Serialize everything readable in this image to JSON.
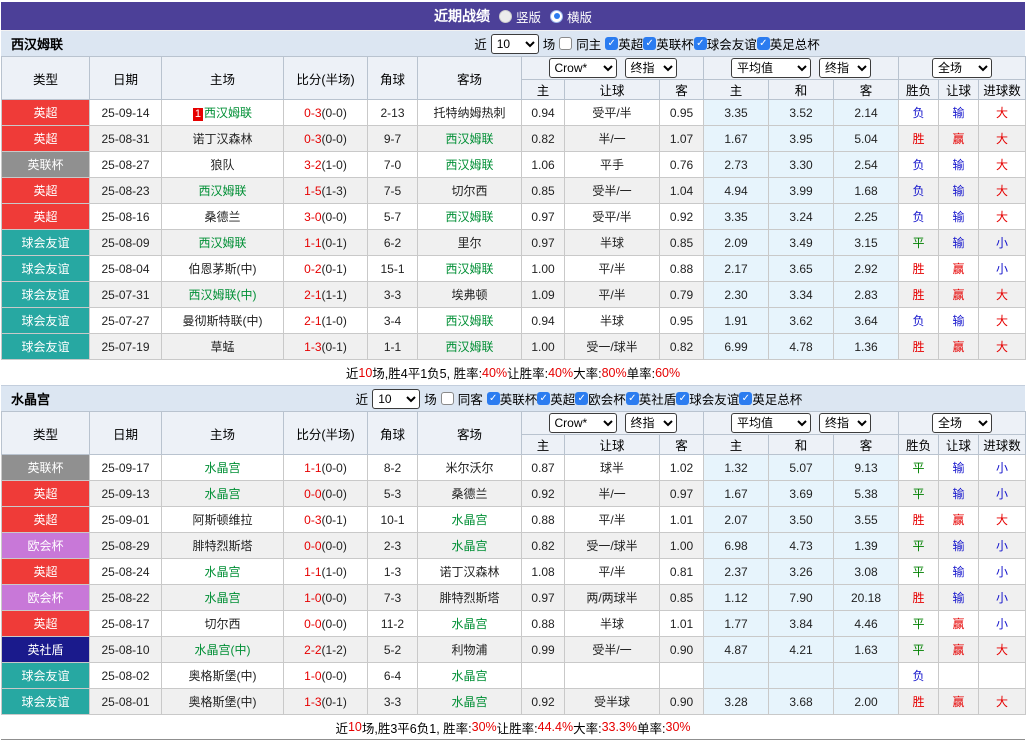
{
  "title_bar": {
    "title": "近期战绩",
    "options": [
      {
        "label": "竖版",
        "selected": false
      },
      {
        "label": "横版",
        "selected": true
      }
    ]
  },
  "table_headers": {
    "main": [
      "类型",
      "日期",
      "主场",
      "比分(半场)",
      "角球",
      "客场"
    ],
    "crow_sub": [
      "主",
      "让球",
      "客"
    ],
    "avg_sub": [
      "主",
      "和",
      "客"
    ],
    "full_sub": [
      "胜负",
      "让球",
      "进球数"
    ]
  },
  "colors": {
    "header_purple": "#4C4098",
    "filter_bar": "#DCE6F2",
    "focus_team_green": "#008F35",
    "score_red": "#E60000",
    "win_red": "#E60000",
    "draw_green": "#008000",
    "lose_blue": "#1414CC"
  },
  "badge_colors": {
    "英超": "#EF3B38",
    "英联杯": "#909090",
    "球会友谊": "#27A8A2",
    "欧会杯": "#C878D8",
    "英社盾": "#1A1A8C"
  },
  "sections": [
    {
      "team": "西汉姆联",
      "filter": {
        "prefix": "近",
        "count": "10",
        "suffix": "场",
        "same_checkbox": {
          "label": "同主",
          "checked": false
        },
        "leagues": [
          "英超",
          "英联杯",
          "球会友谊",
          "英足总杯"
        ]
      },
      "selects": {
        "crow": "Crow*",
        "crow_period": "终指",
        "avg": "平均值",
        "avg_period": "终指",
        "full": "全场"
      },
      "rows": [
        {
          "league": "英超",
          "date": "25-09-14",
          "home": "西汉姆联",
          "home_focus": true,
          "home_rank": "1",
          "score": "0-3",
          "half": "(0-0)",
          "corner": "2-13",
          "away": "托特纳姆热刺",
          "away_focus": false,
          "odds": [
            "0.94",
            "受平/半",
            "0.95"
          ],
          "avg": [
            "3.35",
            "3.52",
            "2.14"
          ],
          "result": "负",
          "handicap": "输",
          "goals": "大"
        },
        {
          "league": "英超",
          "date": "25-08-31",
          "home": "诺丁汉森林",
          "home_focus": false,
          "home_rank": "",
          "score": "0-3",
          "half": "(0-0)",
          "corner": "9-7",
          "away": "西汉姆联",
          "away_focus": true,
          "odds": [
            "0.82",
            "半/一",
            "1.07"
          ],
          "avg": [
            "1.67",
            "3.95",
            "5.04"
          ],
          "result": "胜",
          "handicap": "赢",
          "goals": "大"
        },
        {
          "league": "英联杯",
          "date": "25-08-27",
          "home": "狼队",
          "home_focus": false,
          "home_rank": "",
          "score": "3-2",
          "half": "(1-0)",
          "corner": "7-0",
          "away": "西汉姆联",
          "away_focus": true,
          "odds": [
            "1.06",
            "平手",
            "0.76"
          ],
          "avg": [
            "2.73",
            "3.30",
            "2.54"
          ],
          "result": "负",
          "handicap": "输",
          "goals": "大"
        },
        {
          "league": "英超",
          "date": "25-08-23",
          "home": "西汉姆联",
          "home_focus": true,
          "home_rank": "",
          "score": "1-5",
          "half": "(1-3)",
          "corner": "7-5",
          "away": "切尔西",
          "away_focus": false,
          "odds": [
            "0.85",
            "受半/一",
            "1.04"
          ],
          "avg": [
            "4.94",
            "3.99",
            "1.68"
          ],
          "result": "负",
          "handicap": "输",
          "goals": "大"
        },
        {
          "league": "英超",
          "date": "25-08-16",
          "home": "桑德兰",
          "home_focus": false,
          "home_rank": "",
          "score": "3-0",
          "half": "(0-0)",
          "corner": "5-7",
          "away": "西汉姆联",
          "away_focus": true,
          "odds": [
            "0.97",
            "受平/半",
            "0.92"
          ],
          "avg": [
            "3.35",
            "3.24",
            "2.25"
          ],
          "result": "负",
          "handicap": "输",
          "goals": "大"
        },
        {
          "league": "球会友谊",
          "date": "25-08-09",
          "home": "西汉姆联",
          "home_focus": true,
          "home_rank": "",
          "score": "1-1",
          "half": "(0-1)",
          "corner": "6-2",
          "away": "里尔",
          "away_focus": false,
          "odds": [
            "0.97",
            "半球",
            "0.85"
          ],
          "avg": [
            "2.09",
            "3.49",
            "3.15"
          ],
          "result": "平",
          "handicap": "输",
          "goals": "小"
        },
        {
          "league": "球会友谊",
          "date": "25-08-04",
          "home": "伯恩茅斯(中)",
          "home_focus": false,
          "home_rank": "",
          "score": "0-2",
          "half": "(0-1)",
          "corner": "15-1",
          "away": "西汉姆联",
          "away_focus": true,
          "odds": [
            "1.00",
            "平/半",
            "0.88"
          ],
          "avg": [
            "2.17",
            "3.65",
            "2.92"
          ],
          "result": "胜",
          "handicap": "赢",
          "goals": "小"
        },
        {
          "league": "球会友谊",
          "date": "25-07-31",
          "home": "西汉姆联(中)",
          "home_focus": true,
          "home_rank": "",
          "score": "2-1",
          "half": "(1-1)",
          "corner": "3-3",
          "away": "埃弗顿",
          "away_focus": false,
          "odds": [
            "1.09",
            "平/半",
            "0.79"
          ],
          "avg": [
            "2.30",
            "3.34",
            "2.83"
          ],
          "result": "胜",
          "handicap": "赢",
          "goals": "大"
        },
        {
          "league": "球会友谊",
          "date": "25-07-27",
          "home": "曼彻斯特联(中)",
          "home_focus": false,
          "home_rank": "",
          "score": "2-1",
          "half": "(1-0)",
          "corner": "3-4",
          "away": "西汉姆联",
          "away_focus": true,
          "odds": [
            "0.94",
            "半球",
            "0.95"
          ],
          "avg": [
            "1.91",
            "3.62",
            "3.64"
          ],
          "result": "负",
          "handicap": "输",
          "goals": "大"
        },
        {
          "league": "球会友谊",
          "date": "25-07-19",
          "home": "草蜢",
          "home_focus": false,
          "home_rank": "",
          "score": "1-3",
          "half": "(0-1)",
          "corner": "1-1",
          "away": "西汉姆联",
          "away_focus": true,
          "odds": [
            "1.00",
            "受一/球半",
            "0.82"
          ],
          "avg": [
            "6.99",
            "4.78",
            "1.36"
          ],
          "result": "胜",
          "handicap": "赢",
          "goals": "大"
        }
      ],
      "summary": [
        [
          "近",
          0
        ],
        [
          "10",
          1
        ],
        [
          "场,胜4平1负5, 胜率:",
          0
        ],
        [
          "40%",
          1
        ],
        [
          " 让胜率:",
          0
        ],
        [
          "40%",
          1
        ],
        [
          " 大率:",
          0
        ],
        [
          "80%",
          1
        ],
        [
          " 单率:",
          0
        ],
        [
          "60%",
          1
        ]
      ]
    },
    {
      "team": "水晶宫",
      "filter": {
        "prefix": "近",
        "count": "10",
        "suffix": "场",
        "same_checkbox": {
          "label": "同客",
          "checked": false
        },
        "leagues": [
          "英联杯",
          "英超",
          "欧会杯",
          "英社盾",
          "球会友谊",
          "英足总杯"
        ]
      },
      "selects": {
        "crow": "Crow*",
        "crow_period": "终指",
        "avg": "平均值",
        "avg_period": "终指",
        "full": "全场"
      },
      "rows": [
        {
          "league": "英联杯",
          "date": "25-09-17",
          "home": "水晶宫",
          "home_focus": true,
          "home_rank": "",
          "score": "1-1",
          "half": "(0-0)",
          "corner": "8-2",
          "away": "米尔沃尔",
          "away_focus": false,
          "odds": [
            "0.87",
            "球半",
            "1.02"
          ],
          "avg": [
            "1.32",
            "5.07",
            "9.13"
          ],
          "result": "平",
          "handicap": "输",
          "goals": "小"
        },
        {
          "league": "英超",
          "date": "25-09-13",
          "home": "水晶宫",
          "home_focus": true,
          "home_rank": "",
          "score": "0-0",
          "half": "(0-0)",
          "corner": "5-3",
          "away": "桑德兰",
          "away_focus": false,
          "odds": [
            "0.92",
            "半/一",
            "0.97"
          ],
          "avg": [
            "1.67",
            "3.69",
            "5.38"
          ],
          "result": "平",
          "handicap": "输",
          "goals": "小"
        },
        {
          "league": "英超",
          "date": "25-09-01",
          "home": "阿斯顿维拉",
          "home_focus": false,
          "home_rank": "",
          "score": "0-3",
          "half": "(0-1)",
          "corner": "10-1",
          "away": "水晶宫",
          "away_focus": true,
          "odds": [
            "0.88",
            "平/半",
            "1.01"
          ],
          "avg": [
            "2.07",
            "3.50",
            "3.55"
          ],
          "result": "胜",
          "handicap": "赢",
          "goals": "大"
        },
        {
          "league": "欧会杯",
          "date": "25-08-29",
          "home": "腓特烈斯塔",
          "home_focus": false,
          "home_rank": "",
          "score": "0-0",
          "half": "(0-0)",
          "corner": "2-3",
          "away": "水晶宫",
          "away_focus": true,
          "odds": [
            "0.82",
            "受一/球半",
            "1.00"
          ],
          "avg": [
            "6.98",
            "4.73",
            "1.39"
          ],
          "result": "平",
          "handicap": "输",
          "goals": "小"
        },
        {
          "league": "英超",
          "date": "25-08-24",
          "home": "水晶宫",
          "home_focus": true,
          "home_rank": "",
          "score": "1-1",
          "half": "(1-0)",
          "corner": "1-3",
          "away": "诺丁汉森林",
          "away_focus": false,
          "odds": [
            "1.08",
            "平/半",
            "0.81"
          ],
          "avg": [
            "2.37",
            "3.26",
            "3.08"
          ],
          "result": "平",
          "handicap": "输",
          "goals": "小"
        },
        {
          "league": "欧会杯",
          "date": "25-08-22",
          "home": "水晶宫",
          "home_focus": true,
          "home_rank": "",
          "score": "1-0",
          "half": "(0-0)",
          "corner": "7-3",
          "away": "腓特烈斯塔",
          "away_focus": false,
          "odds": [
            "0.97",
            "两/两球半",
            "0.85"
          ],
          "avg": [
            "1.12",
            "7.90",
            "20.18"
          ],
          "result": "胜",
          "handicap": "输",
          "goals": "小"
        },
        {
          "league": "英超",
          "date": "25-08-17",
          "home": "切尔西",
          "home_focus": false,
          "home_rank": "",
          "score": "0-0",
          "half": "(0-0)",
          "corner": "11-2",
          "away": "水晶宫",
          "away_focus": true,
          "odds": [
            "0.88",
            "半球",
            "1.01"
          ],
          "avg": [
            "1.77",
            "3.84",
            "4.46"
          ],
          "result": "平",
          "handicap": "赢",
          "goals": "小"
        },
        {
          "league": "英社盾",
          "date": "25-08-10",
          "home": "水晶宫(中)",
          "home_focus": true,
          "home_rank": "",
          "score": "2-2",
          "half": "(1-2)",
          "corner": "5-2",
          "away": "利物浦",
          "away_focus": false,
          "odds": [
            "0.99",
            "受半/一",
            "0.90"
          ],
          "avg": [
            "4.87",
            "4.21",
            "1.63"
          ],
          "result": "平",
          "handicap": "赢",
          "goals": "大"
        },
        {
          "league": "球会友谊",
          "date": "25-08-02",
          "home": "奥格斯堡(中)",
          "home_focus": false,
          "home_rank": "",
          "score": "1-0",
          "half": "(0-0)",
          "corner": "6-4",
          "away": "水晶宫",
          "away_focus": true,
          "odds": [
            "",
            "",
            ""
          ],
          "avg": [
            "",
            "",
            ""
          ],
          "result": "负",
          "handicap": "",
          "goals": ""
        },
        {
          "league": "球会友谊",
          "date": "25-08-01",
          "home": "奥格斯堡(中)",
          "home_focus": false,
          "home_rank": "",
          "score": "1-3",
          "half": "(0-1)",
          "corner": "3-3",
          "away": "水晶宫",
          "away_focus": true,
          "odds": [
            "0.92",
            "受半球",
            "0.90"
          ],
          "avg": [
            "3.28",
            "3.68",
            "2.00"
          ],
          "result": "胜",
          "handicap": "赢",
          "goals": "大"
        }
      ],
      "summary": [
        [
          "近",
          0
        ],
        [
          "10",
          1
        ],
        [
          "场,胜3平6负1, 胜率:",
          0
        ],
        [
          "30%",
          1
        ],
        [
          " 让胜率:",
          0
        ],
        [
          "44.4%",
          1
        ],
        [
          " 大率:",
          0
        ],
        [
          "33.3%",
          1
        ],
        [
          " 单率:",
          0
        ],
        [
          "30%",
          1
        ]
      ]
    }
  ]
}
